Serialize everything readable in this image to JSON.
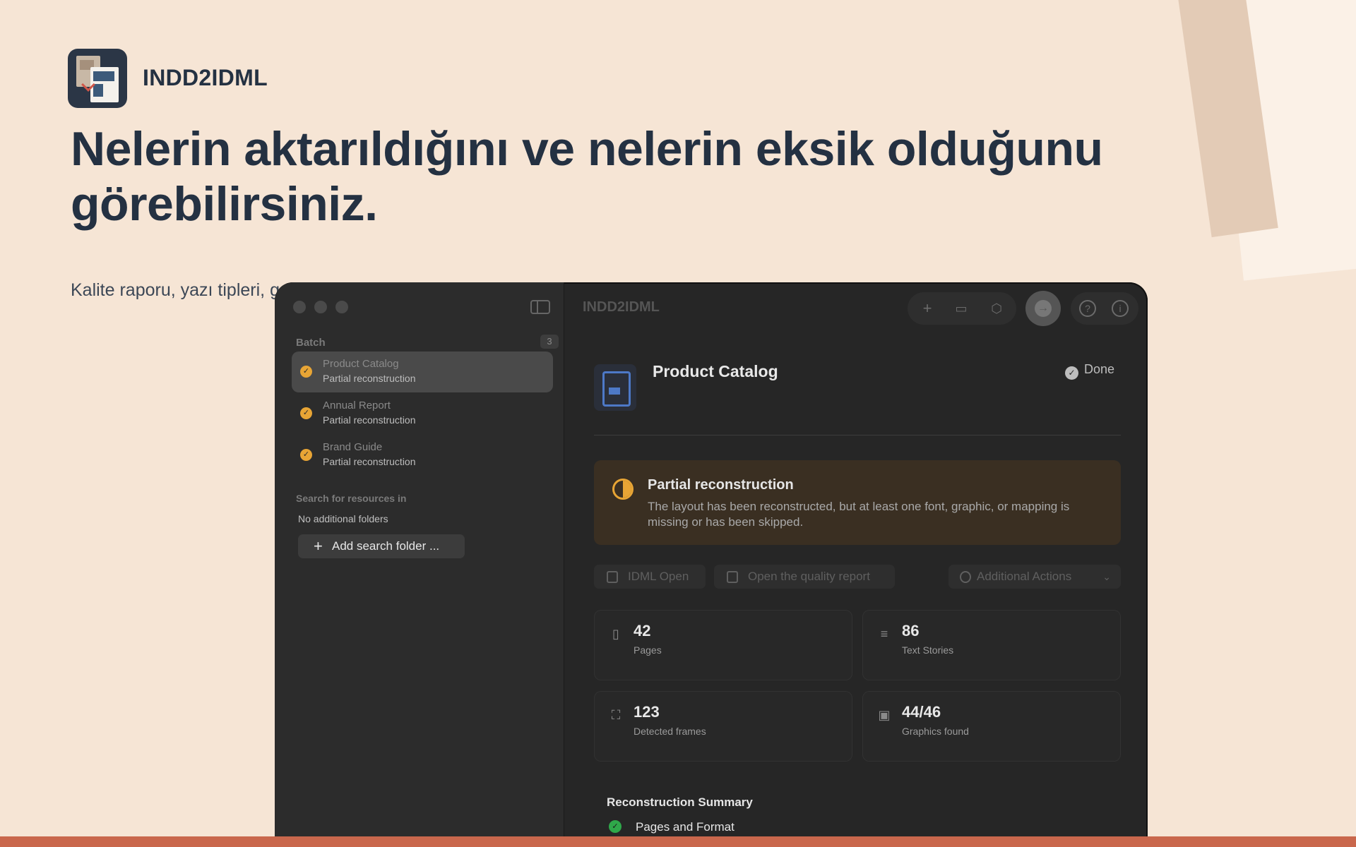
{
  "header": {
    "app_name": "INDD2IDML",
    "headline": "Nelerin aktarıldığını ve nelerin eksik olduğunu görebilirsiniz.",
    "subtitle": "Kalite raporu, yazı tipleri, g"
  },
  "window": {
    "title": "INDD2IDML",
    "sidebar": {
      "batch_label": "Batch",
      "batch_count": "3",
      "items": [
        {
          "title": "Product Catalog",
          "status": "Partial reconstruction"
        },
        {
          "title": "Annual Report",
          "status": "Partial reconstruction"
        },
        {
          "title": "Brand Guide",
          "status": "Partial reconstruction"
        }
      ],
      "search_label": "Search for resources in",
      "no_folders": "No additional folders",
      "add_folder": "Add search folder ..."
    },
    "toolbar": {
      "icons": [
        "plus-icon",
        "folder-icon",
        "package-icon",
        "convert-icon",
        "help-icon",
        "info-icon"
      ]
    },
    "document": {
      "title": "Product Catalog",
      "status": "Done"
    },
    "banner": {
      "title": "Partial reconstruction",
      "text": "The layout has been reconstructed, but at least one font, graphic, or mapping is missing or has been skipped.",
      "accent": "#e8a535"
    },
    "actions": {
      "idml_open": "IDML Open",
      "quality_report": "Open the quality report",
      "additional": "Additional Actions"
    },
    "stats": [
      {
        "value": "42",
        "label": "Pages"
      },
      {
        "value": "86",
        "label": "Text Stories"
      },
      {
        "value": "123",
        "label": "Detected frames"
      },
      {
        "value": "44/46",
        "label": "Graphics found"
      }
    ],
    "summary": {
      "title": "Reconstruction Summary",
      "items": [
        {
          "label": "Pages and Format"
        }
      ]
    }
  },
  "colors": {
    "background": "#f6e5d5",
    "accent_bottom": "#c9674c",
    "text_dark": "#243142"
  }
}
